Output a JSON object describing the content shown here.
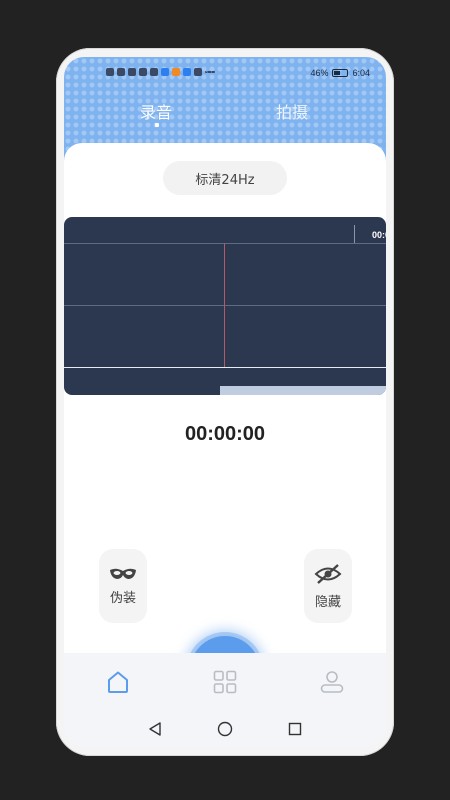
{
  "status_bar": {
    "battery": "46%",
    "time": "6:04"
  },
  "tabs": {
    "record": "录音",
    "shoot": "拍摄"
  },
  "quality": {
    "label": "标清24Hz"
  },
  "waveform": {
    "time_marker": "00:0"
  },
  "timer": {
    "value": "00:00:00"
  },
  "controls": {
    "disguise_label": "伪装",
    "hide_label": "隐藏"
  },
  "icons": {
    "disguise": "mask-icon",
    "record": "microphone-icon",
    "hide": "eye-off-icon",
    "home": "home-icon",
    "apps": "grid-icon",
    "profile": "user-icon",
    "back": "triangle-back-icon",
    "home_sys": "circle-home-icon",
    "recents": "square-recents-icon"
  },
  "colors": {
    "accent": "#5b9cec",
    "header": "#7fb3f0",
    "waveform_bg": "#2c3850"
  }
}
